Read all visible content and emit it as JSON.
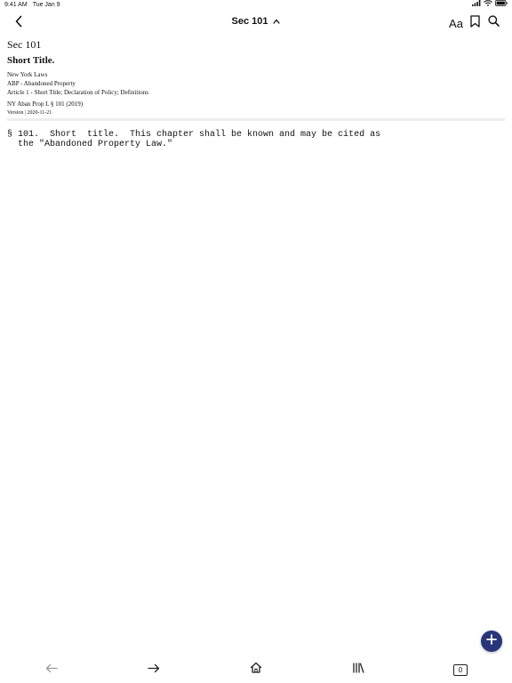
{
  "status": {
    "time": "9:41 AM",
    "date": "Tue Jan 9"
  },
  "nav": {
    "title": "Sec 101",
    "font_button_label": "Aa"
  },
  "document": {
    "section_label": "Sec 101",
    "title": "Short Title.",
    "source": "New York Laws",
    "chapter": "ABP - Abandoned Property",
    "article": "Article 1 - Short Title; Declaration of Policy; Definitions",
    "citation": "NY Aban Prop L § 101 (2019)",
    "version": "Version | 2020-11-21",
    "body": "§ 101.  Short  title.  This chapter shall be known and may be cited as\n  the \"Abandoned Property Law.\""
  },
  "toolbar": {
    "tabs_count": "0"
  },
  "colors": {
    "fab": "#283579",
    "text": "#111111",
    "divider": "#eeeeee"
  }
}
